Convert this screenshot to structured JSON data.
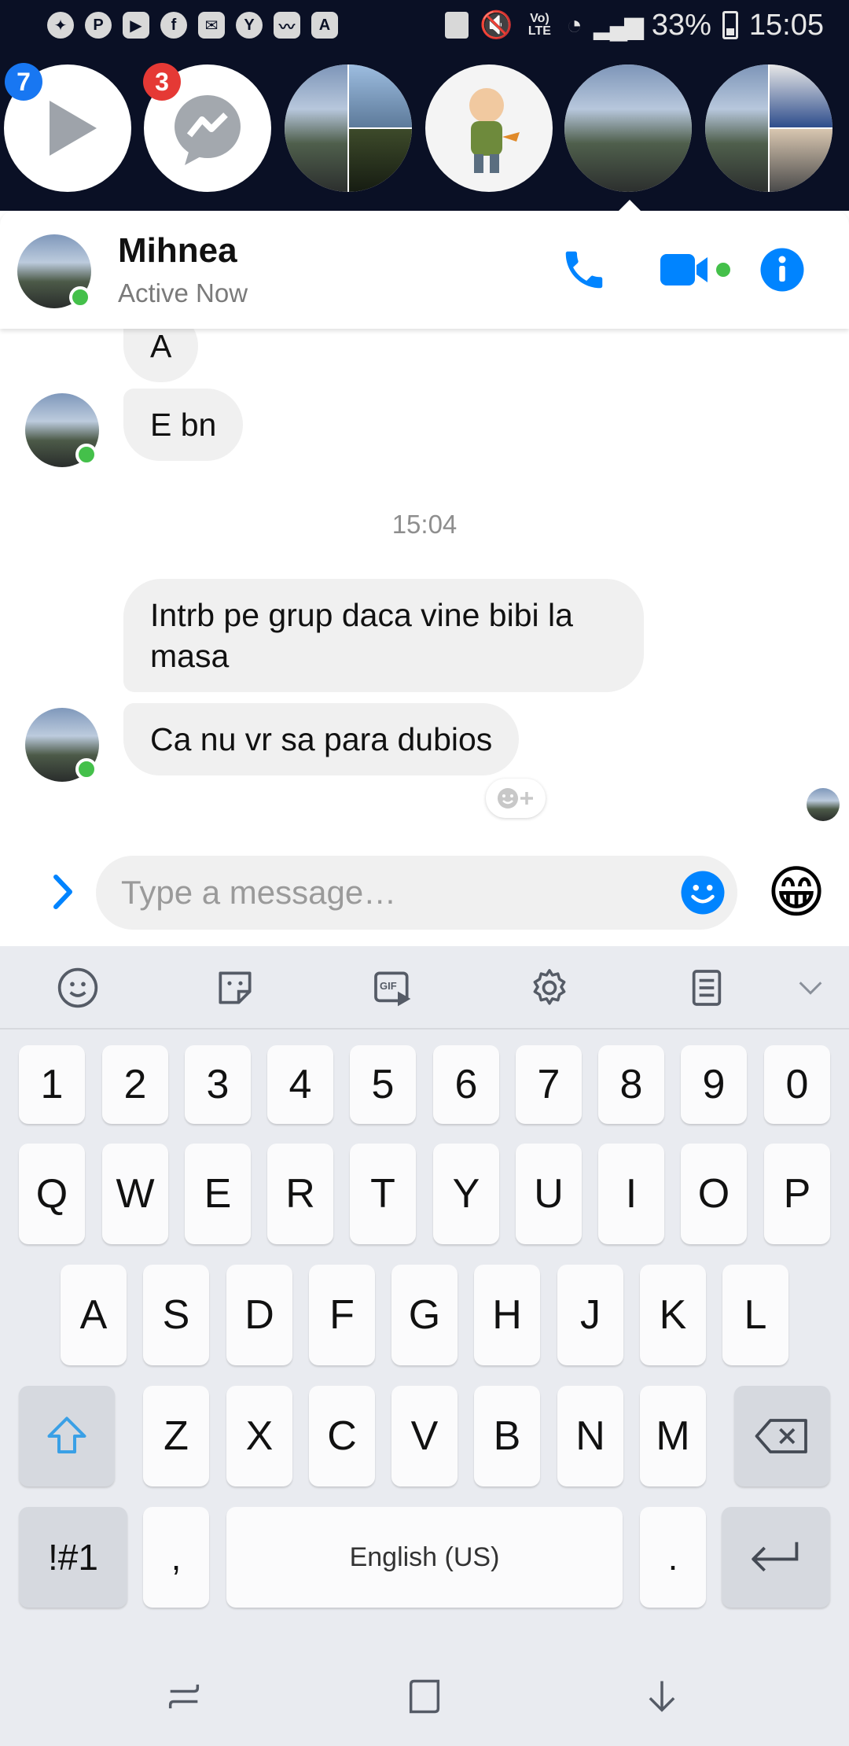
{
  "status_bar": {
    "battery": "33%",
    "time": "15:05",
    "network": "Vo) LTE"
  },
  "chat_heads": [
    {
      "name": "video-app",
      "badge": "7",
      "badge_color": "#1877f2"
    },
    {
      "name": "messenger",
      "badge": "3",
      "badge_color": "#e53935"
    },
    {
      "name": "group-chat-1"
    },
    {
      "name": "cartoon-contact"
    },
    {
      "name": "mihnea",
      "selected": true
    },
    {
      "name": "group-chat-2"
    }
  ],
  "header": {
    "name": "Mihnea",
    "status": "Active Now",
    "accent": "#0084ff",
    "online_color": "#44c04a"
  },
  "messages": [
    {
      "text": "A"
    },
    {
      "text": "E bn"
    },
    {
      "text": "Intrb pe grup daca vine bibi la masa"
    },
    {
      "text": "Ca nu vr sa para dubios"
    }
  ],
  "time_separator": "15:04",
  "composer": {
    "placeholder": "Type a message…",
    "quick_reaction": "😁"
  },
  "keyboard": {
    "toolbar": [
      "emoji-icon",
      "sticker-icon",
      "gif-icon",
      "settings-icon",
      "clipboard-icon",
      "collapse-icon"
    ],
    "gif_label": "GIF",
    "row_numbers": [
      "1",
      "2",
      "3",
      "4",
      "5",
      "6",
      "7",
      "8",
      "9",
      "0"
    ],
    "row_top": [
      "Q",
      "W",
      "E",
      "R",
      "T",
      "Y",
      "U",
      "I",
      "O",
      "P"
    ],
    "row_middle": [
      "A",
      "S",
      "D",
      "F",
      "G",
      "H",
      "J",
      "K",
      "L"
    ],
    "row_bottom": [
      "Z",
      "X",
      "C",
      "V",
      "B",
      "N",
      "M"
    ],
    "symbols_label": "!#1",
    "comma": ",",
    "space_label": "English (US)",
    "period": "."
  }
}
